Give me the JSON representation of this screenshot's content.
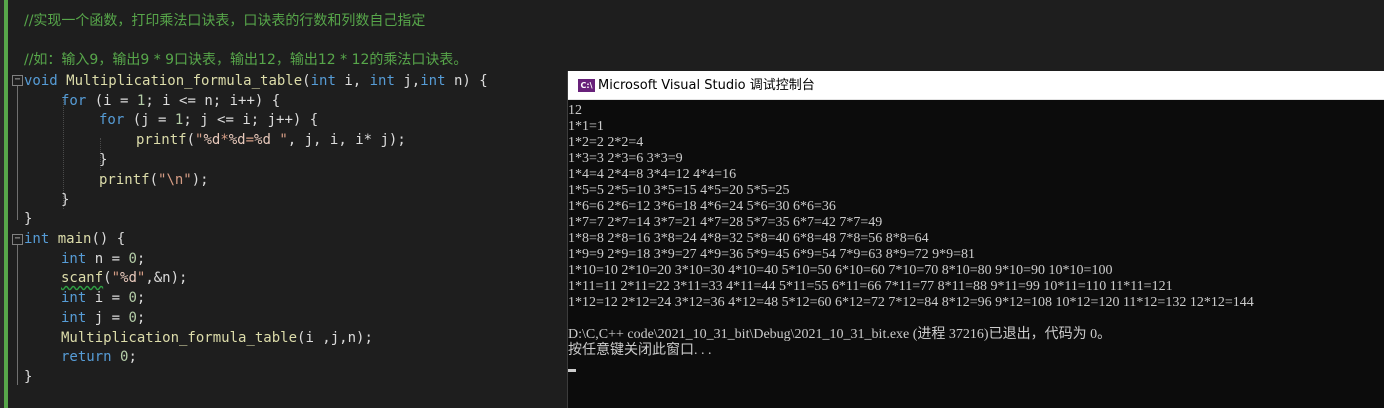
{
  "editor": {
    "comment1": "//实现一个函数，打印乘法口诀表，口诀表的行数和列数自己指定",
    "comment2": "//如：输入9，输出9 * 9口诀表，输出12，输出12 * 12的乘法口诀表。",
    "code": {
      "l1_kw_void": "void",
      "l1_fn": "Multiplication_formula_table",
      "l1_p1": "(",
      "l1_kw_int1": "int",
      "l1_p2": " i, ",
      "l1_kw_int2": "int",
      "l1_p3": " j,",
      "l1_kw_int3": "int",
      "l1_p4": " n) {",
      "l2_kw_for": "for",
      "l2_rest": " (i = ",
      "l2_num1": "1",
      "l2_rest2": "; i <= n; i++) {",
      "l3_kw_for": "for",
      "l3_rest": " (j = ",
      "l3_num1": "1",
      "l3_rest2": "; j <= i; j++) {",
      "l4_fn": "printf",
      "l4_p1": "(",
      "l4_str1": "\"",
      "l4_fmt1": "%d",
      "l4_str2": "*",
      "l4_fmt2": "%d",
      "l4_str3": "=",
      "l4_fmt3": "%d",
      "l4_str4": " \"",
      "l4_rest": ", j, i, i* j);",
      "l5": "}",
      "l6_fn": "printf",
      "l6_p1": "(",
      "l6_str": "\"\\n\"",
      "l6_rest": ");",
      "l7": "}",
      "l8": "}",
      "l9_kw_int": "int",
      "l9_fn": " main",
      "l9_rest": "() {",
      "l10_kw": "int",
      "l10_rest": " n = ",
      "l10_num": "0",
      "l10_end": ";",
      "l11_fn": "scanf",
      "l11_p1": "(",
      "l11_str1": "\"",
      "l11_fmt": "%d",
      "l11_str2": "\"",
      "l11_rest": ",&n);",
      "l12_kw": "int",
      "l12_rest": " i = ",
      "l12_num": "0",
      "l12_end": ";",
      "l13_kw": "int",
      "l13_rest": " j = ",
      "l13_num": "0",
      "l13_end": ";",
      "l14_fn": "Multiplication_formula_table",
      "l14_rest": "(i ,j,n);",
      "l15_kw": "return",
      "l15_rest": " ",
      "l15_num": "0",
      "l15_end": ";",
      "l16": "}"
    },
    "fold_minus": "−"
  },
  "console": {
    "icon_label": "C:\\",
    "title": "Microsoft Visual Studio 调试控制台",
    "lines": [
      "12",
      "1*1=1",
      "1*2=2 2*2=4",
      "1*3=3 2*3=6 3*3=9",
      "1*4=4 2*4=8 3*4=12 4*4=16",
      "1*5=5 2*5=10 3*5=15 4*5=20 5*5=25",
      "1*6=6 2*6=12 3*6=18 4*6=24 5*6=30 6*6=36",
      "1*7=7 2*7=14 3*7=21 4*7=28 5*7=35 6*7=42 7*7=49",
      "1*8=8 2*8=16 3*8=24 4*8=32 5*8=40 6*8=48 7*8=56 8*8=64",
      "1*9=9 2*9=18 3*9=27 4*9=36 5*9=45 6*9=54 7*9=63 8*9=72 9*9=81",
      "1*10=10 2*10=20 3*10=30 4*10=40 5*10=50 6*10=60 7*10=70 8*10=80 9*10=90 10*10=100",
      "1*11=11 2*11=22 3*11=33 4*11=44 5*11=55 6*11=66 7*11=77 8*11=88 9*11=99 10*11=110 11*11=121",
      "1*12=12 2*12=24 3*12=36 4*12=48 5*12=60 6*12=72 7*12=84 8*12=96 9*12=108 10*12=120 11*12=132 12*12=144",
      "",
      "D:\\C,C++ code\\2021_10_31_bit\\Debug\\2021_10_31_bit.exe (进程 37216)已退出，代码为 0。",
      "按任意键关闭此窗口. . ."
    ]
  }
}
